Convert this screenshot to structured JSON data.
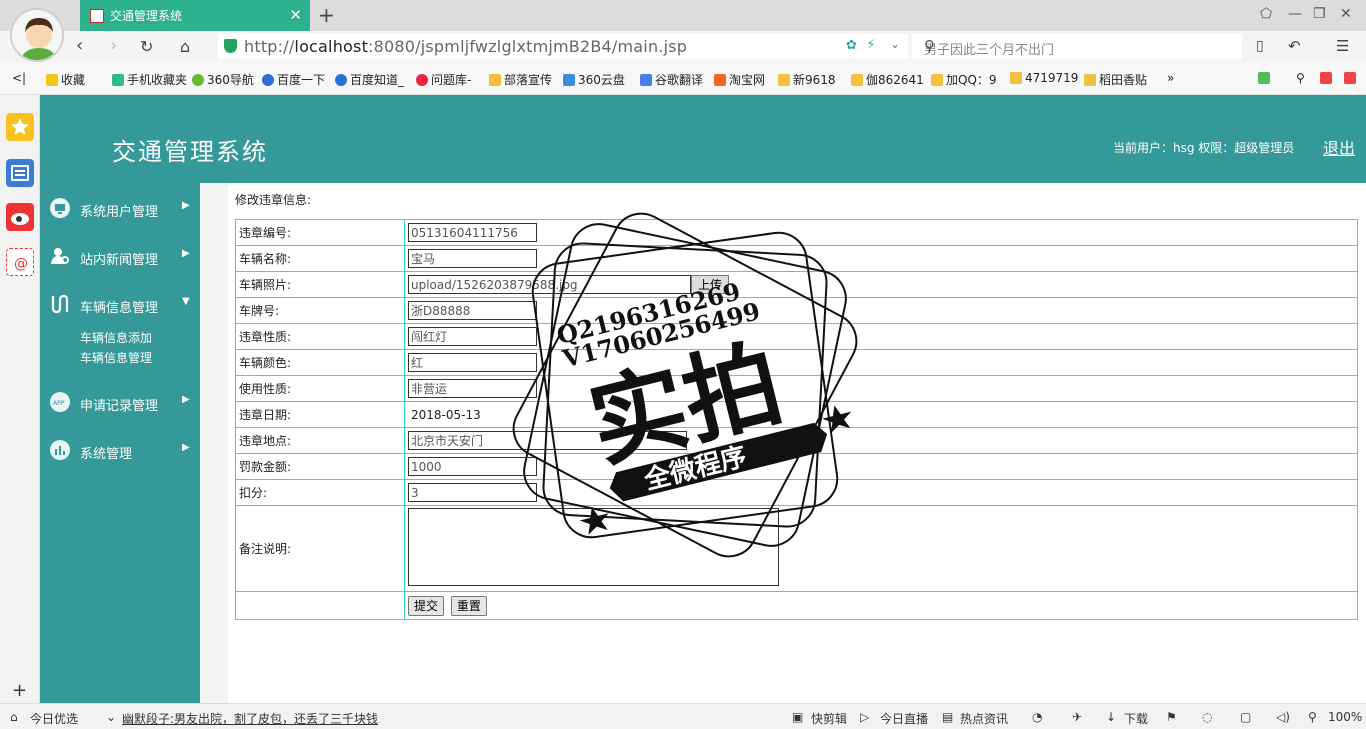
{
  "browser": {
    "tab_title": "交通管理系统",
    "url_host": "localhost",
    "url_prefix": "http://",
    "url_rest": ":8080/jspmljfwzlglxtmjmB2B4/main.jsp",
    "search_placeholder": "男子因此三个月不出门",
    "bookmarks": [
      "收藏",
      "手机收藏夹",
      "360导航",
      "百度一下",
      "百度知道_",
      "问题库-",
      "部落宣传",
      "360云盘",
      "谷歌翻译",
      "淘宝网",
      "新9618",
      "伽862641",
      "加QQ：9",
      "4719719",
      "稻田香贴"
    ]
  },
  "header": {
    "title": "交通管理系统",
    "user_info": "当前用户：hsg  权限：超级管理员",
    "logout": "退出"
  },
  "menu": {
    "items": [
      {
        "label": "系统用户管理",
        "arrow": "▶"
      },
      {
        "label": "站内新闻管理",
        "arrow": "▶"
      },
      {
        "label": "车辆信息管理",
        "arrow": "▼"
      },
      {
        "label": "申请记录管理",
        "arrow": "▶"
      },
      {
        "label": "系统管理",
        "arrow": "▶"
      }
    ],
    "subitems": [
      "车辆信息添加",
      "车辆信息管理"
    ]
  },
  "form": {
    "heading": "修改违章信息:",
    "rows": [
      {
        "label": "违章编号:",
        "value": "05131604111756"
      },
      {
        "label": "车辆名称:",
        "value": "宝马"
      },
      {
        "label": "车辆照片:",
        "value": "upload/1526203879588.jpg"
      },
      {
        "label": "车牌号:",
        "value": "浙D88888"
      },
      {
        "label": "违章性质:",
        "value": "闯红灯"
      },
      {
        "label": "车辆颜色:",
        "value": "红"
      },
      {
        "label": "使用性质:",
        "value": "非营运"
      },
      {
        "label": "违章日期:",
        "value": "2018-05-13"
      },
      {
        "label": "违章地点:",
        "value": "北京市天安门"
      },
      {
        "label": "罚款金额:",
        "value": "1000"
      },
      {
        "label": "扣分:",
        "value": "3"
      }
    ],
    "remark_label": "备注说明:",
    "upload_label": "上传",
    "submit_label": "提交",
    "reset_label": "重置"
  },
  "watermark": {
    "line1": "Q2196316269",
    "line2": "V17060256499",
    "main": "实拍",
    "banner": "全微程序"
  },
  "statusbar": {
    "left": "今日优选",
    "news": "幽默段子:男友出院，割了皮包，还丢了三千块钱",
    "items": [
      "快剪辑",
      "今日直播",
      "热点资讯",
      "下载"
    ],
    "zoom": "100%"
  },
  "colors": {
    "accent": "#35999a",
    "table_border": "#3ad6d6",
    "tab_green": "#2db08c"
  }
}
